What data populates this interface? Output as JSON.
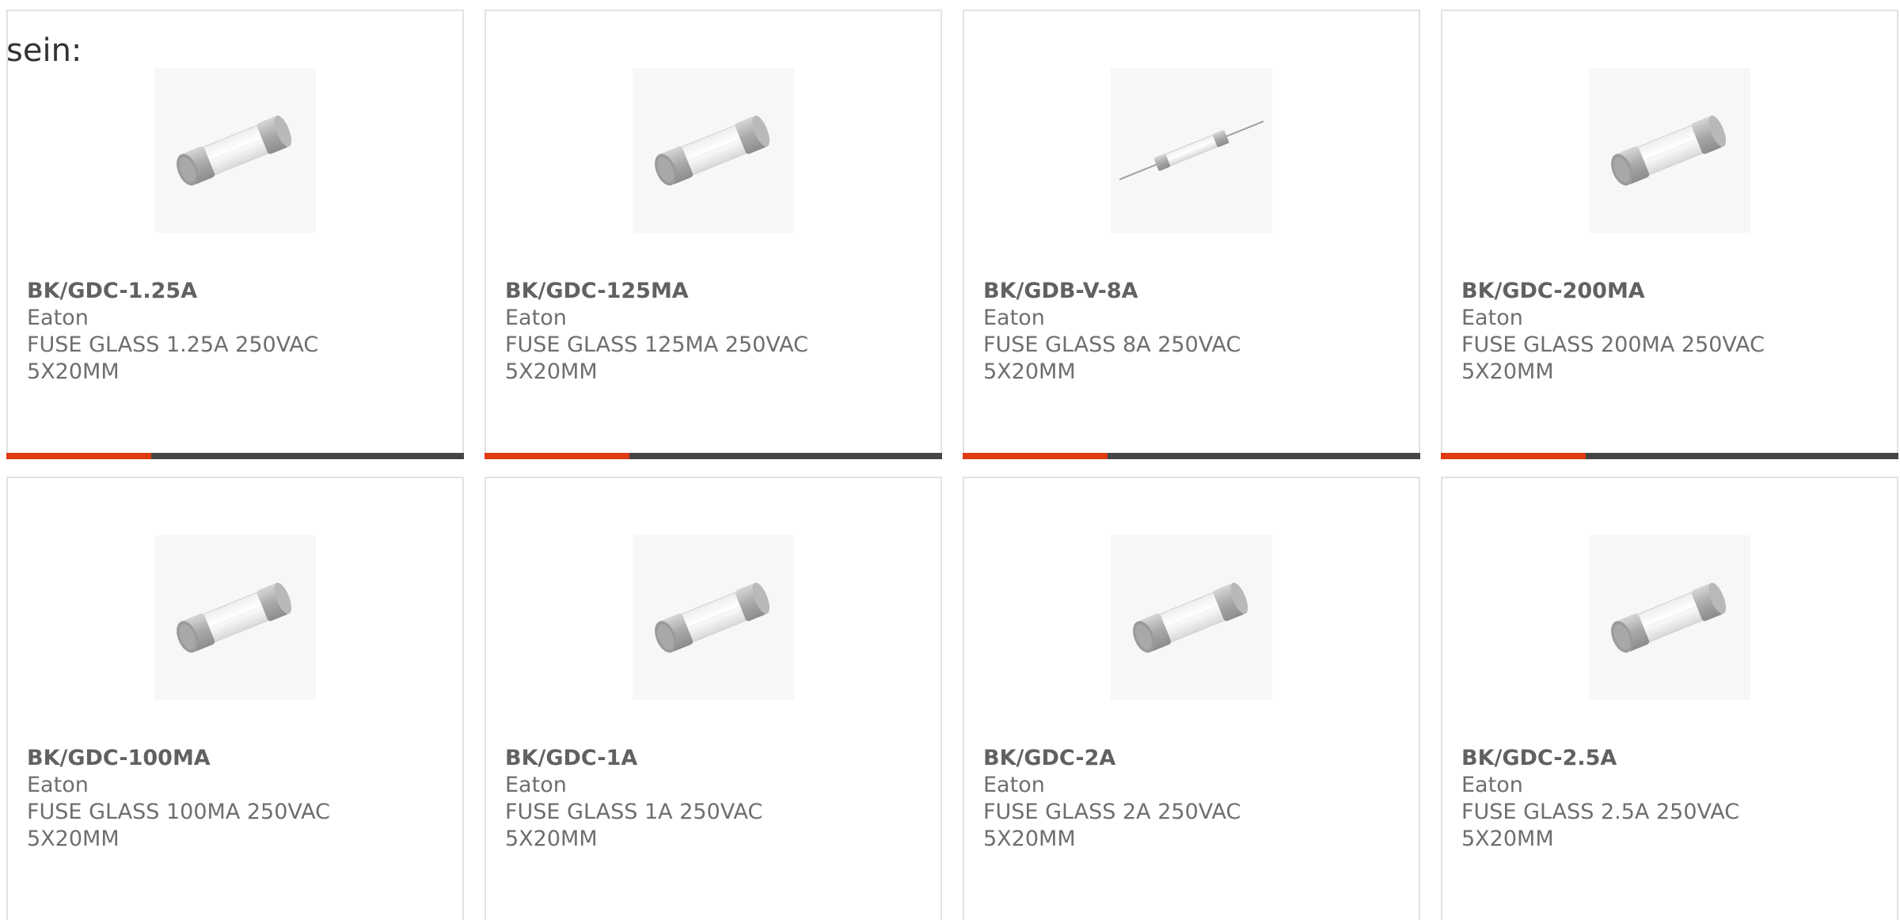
{
  "intro_text": "sein:",
  "colors": {
    "accent_red": "#e03a0f",
    "accent_dark": "#454545",
    "text": "#6e6e6e"
  },
  "products": [
    {
      "part_number": "BK/GDC-1.25A",
      "manufacturer": "Eaton",
      "description": "FUSE GLASS 1.25A 250VAC 5X20MM",
      "image": "glass-cartridge-fuse"
    },
    {
      "part_number": "BK/GDC-125MA",
      "manufacturer": "Eaton",
      "description": "FUSE GLASS 125MA 250VAC 5X20MM",
      "image": "glass-cartridge-fuse"
    },
    {
      "part_number": "BK/GDB-V-8A",
      "manufacturer": "Eaton",
      "description": "FUSE GLASS 8A 250VAC 5X20MM",
      "image": "axial-lead-fuse"
    },
    {
      "part_number": "BK/GDC-200MA",
      "manufacturer": "Eaton",
      "description": "FUSE GLASS 200MA 250VAC 5X20MM",
      "image": "glass-cartridge-fuse"
    },
    {
      "part_number": "BK/GDC-100MA",
      "manufacturer": "Eaton",
      "description": "FUSE GLASS 100MA 250VAC 5X20MM",
      "image": "glass-cartridge-fuse"
    },
    {
      "part_number": "BK/GDC-1A",
      "manufacturer": "Eaton",
      "description": "FUSE GLASS 1A 250VAC 5X20MM",
      "image": "glass-cartridge-fuse"
    },
    {
      "part_number": "BK/GDC-2A",
      "manufacturer": "Eaton",
      "description": "FUSE GLASS 2A 250VAC 5X20MM",
      "image": "glass-cartridge-fuse"
    },
    {
      "part_number": "BK/GDC-2.5A",
      "manufacturer": "Eaton",
      "description": "FUSE GLASS 2.5A 250VAC 5X20MM",
      "image": "glass-cartridge-fuse"
    }
  ]
}
